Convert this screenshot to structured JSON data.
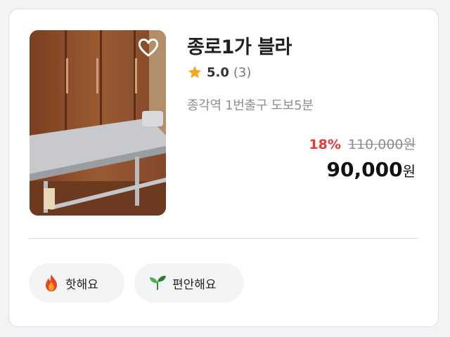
{
  "listing": {
    "title": "종로1가 블라",
    "rating": "5.0",
    "review_count": "(3)",
    "location": "종각역 1번출구 도보5분",
    "discount": "18%",
    "original_price": "110,000원",
    "price": "90,000",
    "price_unit": "원",
    "favorite_icon": "heart-outline-icon",
    "star_icon": "star-icon"
  },
  "tags": [
    {
      "label": "핫해요",
      "icon": "fire-icon"
    },
    {
      "label": "편안해요",
      "icon": "leaf-icon"
    }
  ],
  "colors": {
    "discount": "#e53935",
    "star": "#f5a623",
    "tag_bg": "#f3f4f6"
  }
}
